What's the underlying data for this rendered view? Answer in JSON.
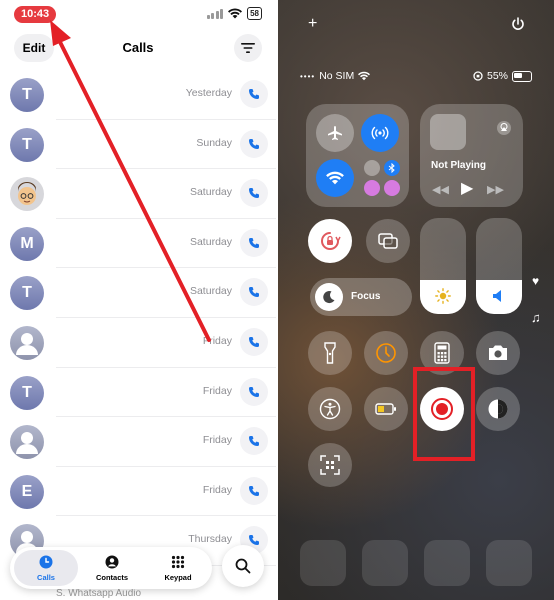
{
  "left_screen": {
    "status": {
      "time": "10:43",
      "battery": "58"
    },
    "header": {
      "edit_label": "Edit",
      "title": "Calls"
    },
    "calls": [
      {
        "avatar": "T",
        "day": "Yesterday"
      },
      {
        "avatar": "T",
        "day": "Sunday"
      },
      {
        "avatar": "memoji",
        "day": "Saturday"
      },
      {
        "avatar": "M",
        "day": "Saturday"
      },
      {
        "avatar": "T",
        "day": "Saturday"
      },
      {
        "avatar": "person",
        "day": "Friday"
      },
      {
        "avatar": "T",
        "day": "Friday"
      },
      {
        "avatar": "person",
        "day": "Friday"
      },
      {
        "avatar": "E",
        "day": "Friday"
      },
      {
        "avatar": "person",
        "day": "Thursday"
      }
    ],
    "partial_text": "S. Whatsapp Audio",
    "tabs": [
      {
        "label": "Calls",
        "icon": "clock-icon",
        "active": true
      },
      {
        "label": "Contacts",
        "icon": "person-icon",
        "active": false
      },
      {
        "label": "Keypad",
        "icon": "keypad-icon",
        "active": false
      }
    ],
    "colors": {
      "accent": "#1a73e8",
      "time_pill": "#e63a3f",
      "arrow": "#e32026"
    }
  },
  "right_screen": {
    "carrier": "No SIM",
    "battery": "55%",
    "now_playing": "Not Playing",
    "focus_label": "Focus",
    "brightness_level": 0.35,
    "volume_level": 0.35,
    "highlight_color": "#e32026"
  }
}
